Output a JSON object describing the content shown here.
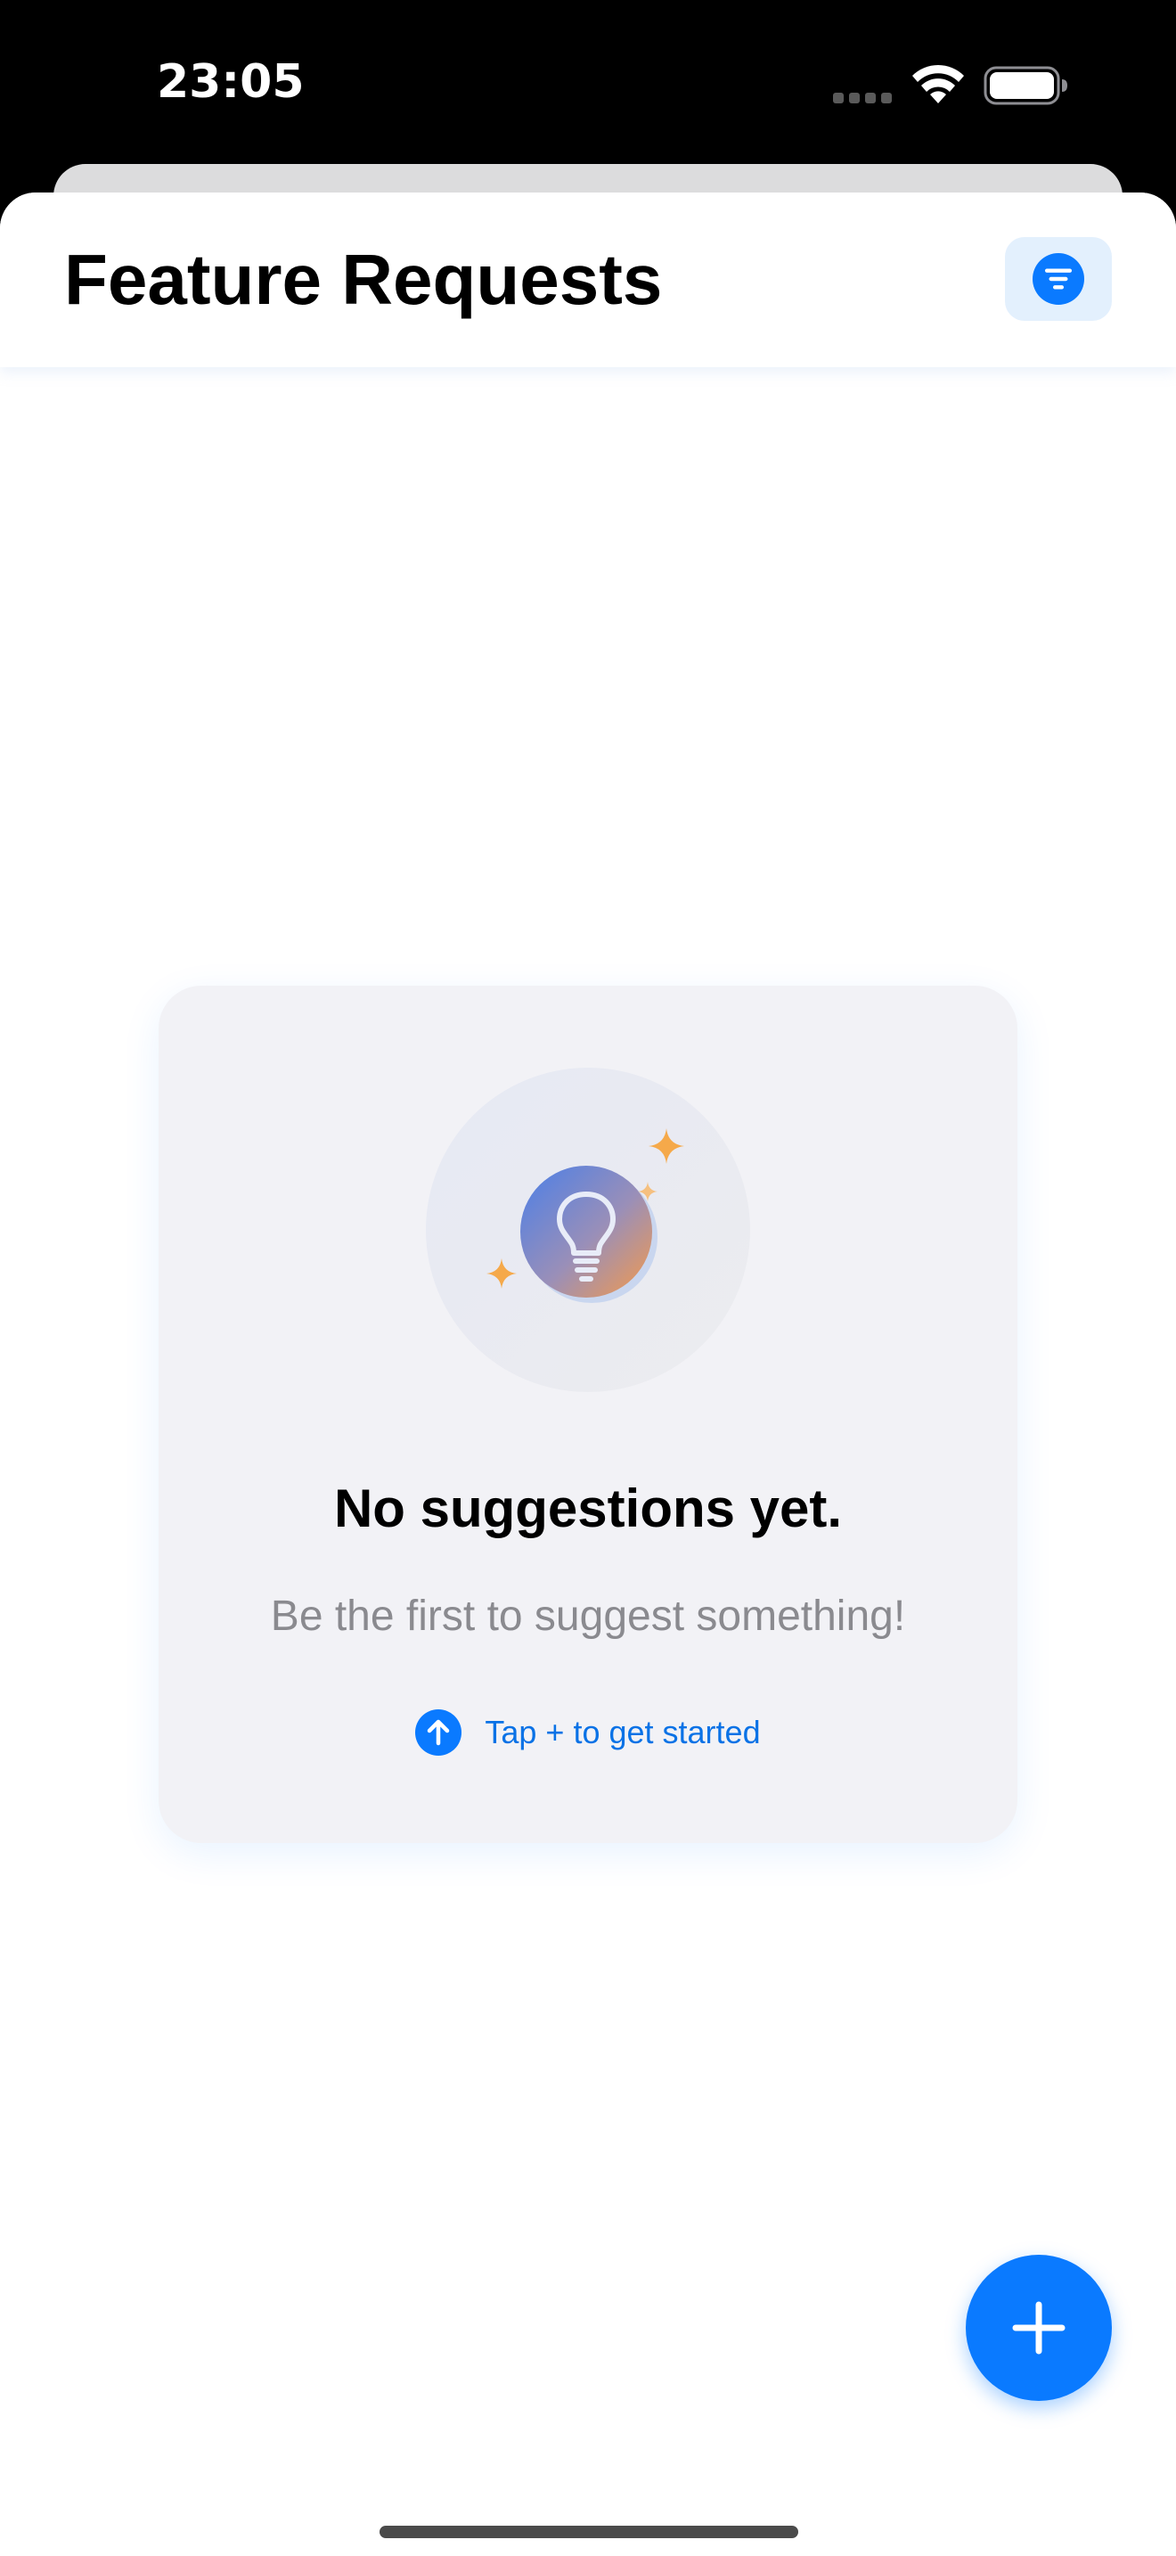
{
  "status_bar": {
    "time": "23:05"
  },
  "header": {
    "title": "Feature Requests",
    "filter_icon": "filter-lines-icon"
  },
  "empty_state": {
    "illustration_icon": "lightbulb-icon",
    "title": "No suggestions yet.",
    "subtitle": "Be the first to suggest something!",
    "hint": "Tap + to get started",
    "hint_icon": "arrow-up-circle-icon"
  },
  "fab": {
    "icon": "plus-icon"
  },
  "colors": {
    "accent": "#0A7AFF",
    "hint_text": "#0A72E6",
    "card_background": "#F2F2F6",
    "subtitle_text": "#8A8A8F",
    "sparkle": "#F5A94A"
  }
}
